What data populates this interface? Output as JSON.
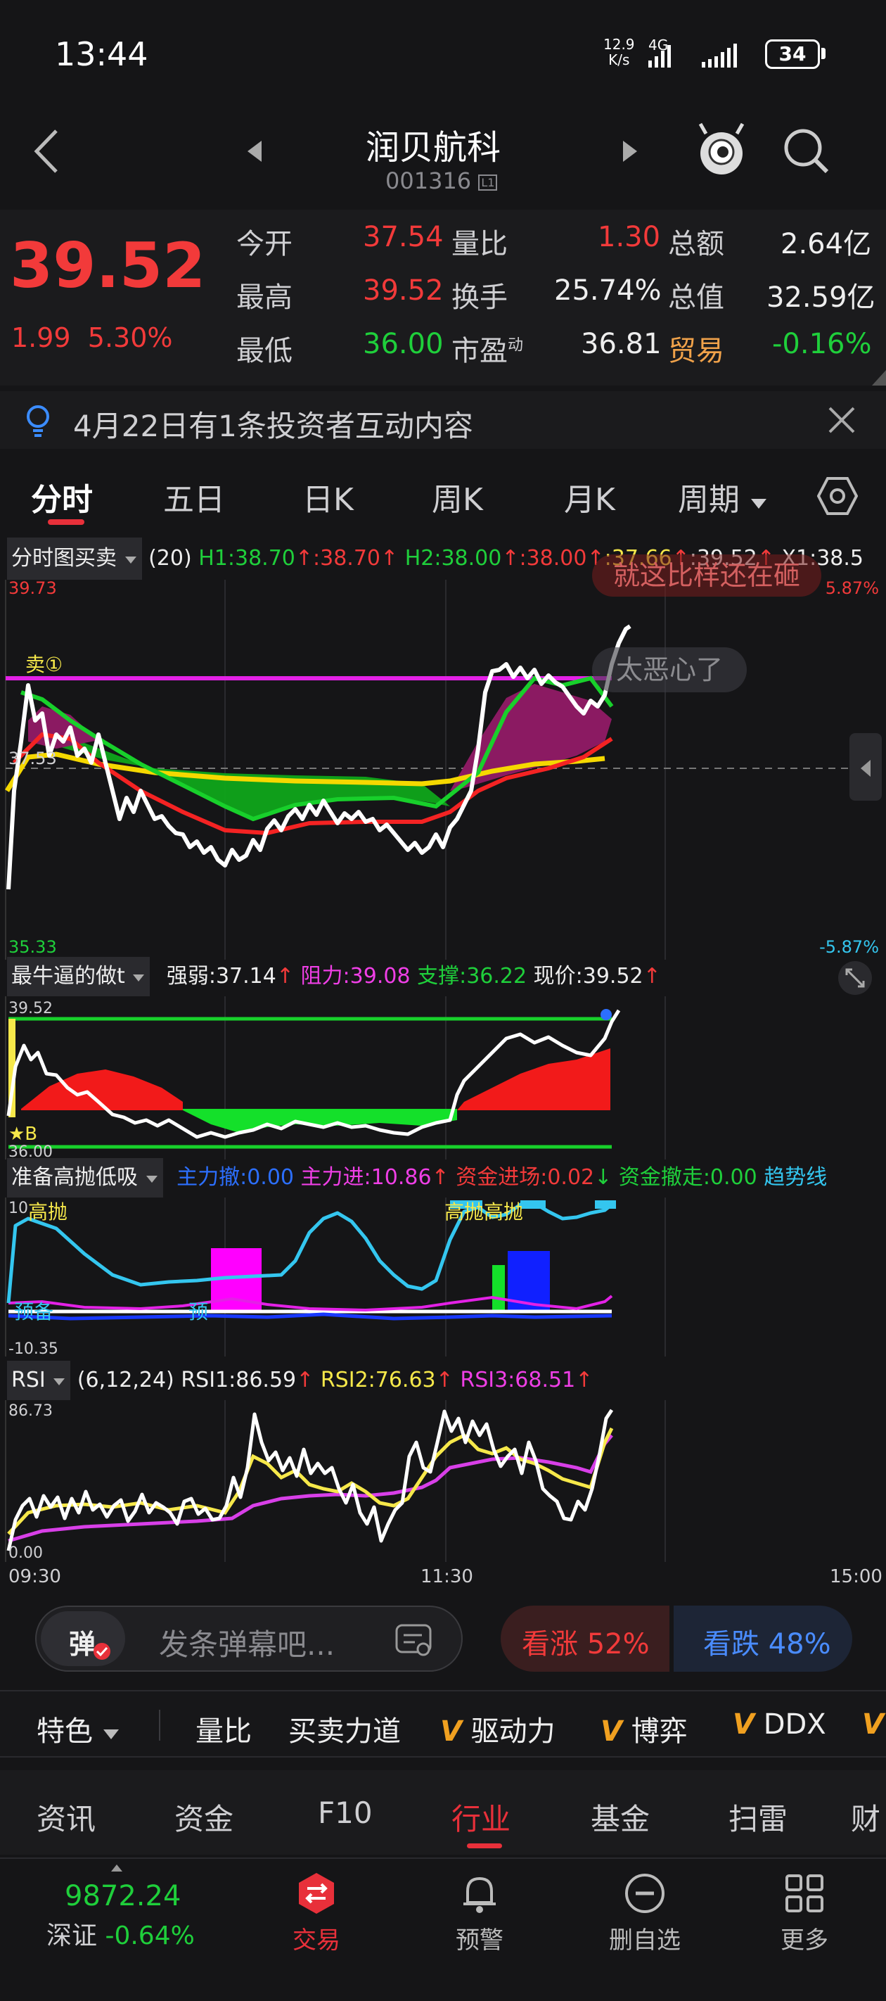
{
  "status_bar": {
    "time": "13:44",
    "net_speed_top": "12.9",
    "net_speed_bottom": "K/s",
    "network": "4G",
    "battery": "34"
  },
  "header": {
    "stock_name": "润贝航科",
    "stock_code": "001316",
    "level_badge": "L1"
  },
  "quote": {
    "price": "39.52",
    "change": "1.99",
    "change_pct": "5.30%",
    "rows": [
      {
        "l1": "今开",
        "v1": "37.54",
        "l2": "量比",
        "v2": "1.30",
        "l3": "总额",
        "v3": "2.64亿"
      },
      {
        "l1": "最高",
        "v1": "39.52",
        "l2": "换手",
        "v2": "25.74%",
        "l3": "总值",
        "v3": "32.59亿"
      },
      {
        "l1": "最低",
        "v1": "36.00",
        "l2": "市盈",
        "v2": "36.81",
        "l3": "贸易",
        "v3": "-0.16%"
      }
    ],
    "pe_superscript": "动"
  },
  "notice": {
    "text": "4月22日有1条投资者互动内容"
  },
  "period_tabs": [
    "分时",
    "五日",
    "日K",
    "周K",
    "月K",
    "周期"
  ],
  "main_panel": {
    "selector": "分时图买卖",
    "params": "(20)",
    "h1": "H1:38.70",
    "h1b": ":38.70",
    "h2": "H2:38.00",
    "h2b": ":38.00",
    "v3": ":37.66",
    "v4": ":39.52",
    "x1": "X1:38.5",
    "top_price": "39.73",
    "top_pct": "5.87%",
    "mid_price": "37.53",
    "bottom_price": "35.33",
    "bottom_pct": "-5.87%",
    "sell_marker": "卖①",
    "danmaku1": "就这比样还在砸",
    "danmaku2": "太恶心了"
  },
  "panel2": {
    "selector": "最牛逼的做t",
    "strength": "强弱:37.14",
    "resistance": "阻力:39.08",
    "support": "支撑:36.22",
    "current": "现价:39.52",
    "top": "39.52",
    "bottom": "36.00",
    "marker": "★B"
  },
  "panel3": {
    "selector": "准备高抛低吸",
    "main_out": "主力撤:0.00",
    "main_in": "主力进:10.86",
    "fund_in": "资金进场:0.02",
    "fund_out": "资金撤走:0.00",
    "trend": "趋势线",
    "top": "10",
    "bottom": "-10.35",
    "label_high1": "高抛",
    "label_high2": "高抛高抛",
    "label_prep1": "预备",
    "label_prep2": "预"
  },
  "panel4": {
    "selector": "RSI",
    "params": "(6,12,24)",
    "rsi1": "RSI1:86.59",
    "rsi2": "RSI2:76.63",
    "rsi3": "RSI3:68.51",
    "top": "86.73",
    "bottom": "0.00"
  },
  "time_axis": [
    "09:30",
    "11:30",
    "15:00"
  ],
  "danmaku_bar": {
    "icon_label": "弹",
    "placeholder": "发条弹幕吧...",
    "bull": "看涨 52%",
    "bear": "看跌 48%"
  },
  "indicator_tabs": {
    "special": "特色",
    "items": [
      "量比",
      "买卖力道",
      "驱动力",
      "博弈",
      "DDX"
    ],
    "vip_mark": "V"
  },
  "info_tabs": [
    "资讯",
    "资金",
    "F10",
    "行业",
    "基金",
    "扫雷",
    "财"
  ],
  "bottom_nav": {
    "index_value": "9872.24",
    "index_name": "深证",
    "index_change": "-0.64%",
    "items": [
      "交易",
      "预警",
      "删自选",
      "更多"
    ]
  },
  "colors": {
    "up": "#f23a3a",
    "down": "#1fcf3b",
    "background": "#151517",
    "accent": "#e8303a"
  }
}
